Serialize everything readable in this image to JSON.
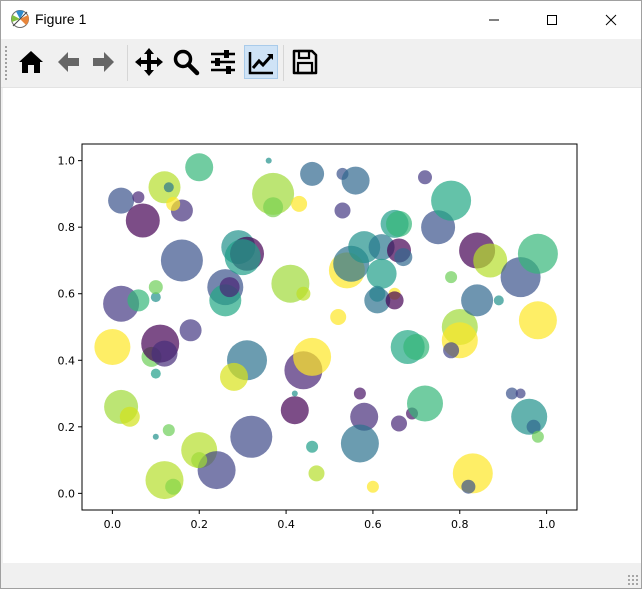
{
  "window": {
    "title": "Figure 1",
    "icon": "matplotlib-icon",
    "controls": [
      "minimize-icon",
      "maximize-icon",
      "close-icon"
    ]
  },
  "toolbar": {
    "buttons": [
      {
        "name": "home",
        "icon": "home-icon"
      },
      {
        "name": "back",
        "icon": "back-arrow-icon"
      },
      {
        "name": "forward",
        "icon": "forward-arrow-icon"
      },
      {
        "name": "pan",
        "icon": "move-icon"
      },
      {
        "name": "zoom",
        "icon": "magnifier-icon"
      },
      {
        "name": "subplots",
        "icon": "sliders-icon"
      },
      {
        "name": "edit-axes",
        "icon": "line-chart-icon",
        "active": true
      },
      {
        "name": "save",
        "icon": "floppy-disk-icon"
      }
    ]
  },
  "chart_data": {
    "type": "scatter",
    "title": "",
    "xlabel": "",
    "ylabel": "",
    "xlim": [
      -0.07,
      1.07
    ],
    "ylim": [
      -0.05,
      1.05
    ],
    "xticks": [
      0.0,
      0.2,
      0.4,
      0.6,
      0.8,
      1.0
    ],
    "yticks": [
      0.0,
      0.2,
      0.4,
      0.6,
      0.8,
      1.0
    ],
    "xtick_labels": [
      "0.0",
      "0.2",
      "0.4",
      "0.6",
      "0.8",
      "1.0"
    ],
    "ytick_labels": [
      "0.0",
      "0.2",
      "0.4",
      "0.6",
      "0.8",
      "1.0"
    ],
    "grid": false,
    "alpha": 0.7,
    "colormap": "viridis",
    "note_size": "marker radius in px",
    "points": [
      {
        "x": 0.02,
        "y": 0.88,
        "r": 13,
        "c": "#3b528b"
      },
      {
        "x": 0.06,
        "y": 0.89,
        "r": 6,
        "c": "#482878"
      },
      {
        "x": 0.07,
        "y": 0.82,
        "r": 17,
        "c": "#440154"
      },
      {
        "x": 0.12,
        "y": 0.92,
        "r": 16,
        "c": "#b5de2b"
      },
      {
        "x": 0.13,
        "y": 0.92,
        "r": 5,
        "c": "#2a788e"
      },
      {
        "x": 0.16,
        "y": 0.85,
        "r": 11,
        "c": "#46327e"
      },
      {
        "x": 0.14,
        "y": 0.87,
        "r": 7,
        "c": "#fde725"
      },
      {
        "x": 0.2,
        "y": 0.98,
        "r": 14,
        "c": "#35b779"
      },
      {
        "x": 0.16,
        "y": 0.7,
        "r": 21,
        "c": "#3b528b"
      },
      {
        "x": 0.02,
        "y": 0.57,
        "r": 18,
        "c": "#443983"
      },
      {
        "x": 0.06,
        "y": 0.58,
        "r": 11,
        "c": "#35b779"
      },
      {
        "x": 0.1,
        "y": 0.59,
        "r": 5,
        "c": "#21918c"
      },
      {
        "x": 0.1,
        "y": 0.62,
        "r": 7,
        "c": "#6ece58"
      },
      {
        "x": 0.0,
        "y": 0.44,
        "r": 18,
        "c": "#fde725"
      },
      {
        "x": 0.09,
        "y": 0.41,
        "r": 10,
        "c": "#6ece58"
      },
      {
        "x": 0.11,
        "y": 0.45,
        "r": 19,
        "c": "#440154"
      },
      {
        "x": 0.12,
        "y": 0.42,
        "r": 13,
        "c": "#472d7b"
      },
      {
        "x": 0.1,
        "y": 0.36,
        "r": 5,
        "c": "#1f9e89"
      },
      {
        "x": 0.18,
        "y": 0.49,
        "r": 11,
        "c": "#443983"
      },
      {
        "x": 0.02,
        "y": 0.26,
        "r": 17,
        "c": "#a0da39"
      },
      {
        "x": 0.04,
        "y": 0.23,
        "r": 10,
        "c": "#d2e21b"
      },
      {
        "x": 0.1,
        "y": 0.17,
        "r": 3,
        "c": "#21918c"
      },
      {
        "x": 0.13,
        "y": 0.19,
        "r": 6,
        "c": "#6ece58"
      },
      {
        "x": 0.12,
        "y": 0.04,
        "r": 19,
        "c": "#b5de2b"
      },
      {
        "x": 0.14,
        "y": 0.02,
        "r": 8,
        "c": "#86d549"
      },
      {
        "x": 0.2,
        "y": 0.13,
        "r": 18,
        "c": "#b5de2b"
      },
      {
        "x": 0.24,
        "y": 0.07,
        "r": 19,
        "c": "#414487"
      },
      {
        "x": 0.2,
        "y": 0.1,
        "r": 8,
        "c": "#a0da39"
      },
      {
        "x": 0.32,
        "y": 0.17,
        "r": 21,
        "c": "#3e4a89"
      },
      {
        "x": 0.31,
        "y": 0.4,
        "r": 20,
        "c": "#2c728e"
      },
      {
        "x": 0.28,
        "y": 0.35,
        "r": 14,
        "c": "#d8e219"
      },
      {
        "x": 0.26,
        "y": 0.62,
        "r": 18,
        "c": "#3b528b"
      },
      {
        "x": 0.26,
        "y": 0.58,
        "r": 16,
        "c": "#22a884"
      },
      {
        "x": 0.27,
        "y": 0.62,
        "r": 10,
        "c": "#482475"
      },
      {
        "x": 0.29,
        "y": 0.74,
        "r": 17,
        "c": "#21918c"
      },
      {
        "x": 0.31,
        "y": 0.72,
        "r": 17,
        "c": "#440154"
      },
      {
        "x": 0.3,
        "y": 0.71,
        "r": 18,
        "c": "#1f9e89"
      },
      {
        "x": 0.37,
        "y": 0.9,
        "r": 21,
        "c": "#a0da39"
      },
      {
        "x": 0.37,
        "y": 0.86,
        "r": 10,
        "c": "#7ad151"
      },
      {
        "x": 0.36,
        "y": 1.0,
        "r": 3,
        "c": "#21918c"
      },
      {
        "x": 0.43,
        "y": 0.87,
        "r": 8,
        "c": "#fde725"
      },
      {
        "x": 0.46,
        "y": 0.96,
        "r": 12,
        "c": "#31688e"
      },
      {
        "x": 0.41,
        "y": 0.63,
        "r": 19,
        "c": "#a0da39"
      },
      {
        "x": 0.44,
        "y": 0.6,
        "r": 7,
        "c": "#bddf26"
      },
      {
        "x": 0.44,
        "y": 0.37,
        "r": 19,
        "c": "#482475"
      },
      {
        "x": 0.46,
        "y": 0.41,
        "r": 19,
        "c": "#fde725"
      },
      {
        "x": 0.42,
        "y": 0.25,
        "r": 14,
        "c": "#440154"
      },
      {
        "x": 0.42,
        "y": 0.3,
        "r": 3,
        "c": "#21918c"
      },
      {
        "x": 0.46,
        "y": 0.14,
        "r": 6,
        "c": "#1f9e89"
      },
      {
        "x": 0.47,
        "y": 0.06,
        "r": 8,
        "c": "#b5de2b"
      },
      {
        "x": 0.53,
        "y": 0.96,
        "r": 6,
        "c": "#3b528b"
      },
      {
        "x": 0.56,
        "y": 0.94,
        "r": 14,
        "c": "#31688e"
      },
      {
        "x": 0.53,
        "y": 0.85,
        "r": 8,
        "c": "#443983"
      },
      {
        "x": 0.54,
        "y": 0.67,
        "r": 18,
        "c": "#fde725"
      },
      {
        "x": 0.55,
        "y": 0.69,
        "r": 18,
        "c": "#2c728e"
      },
      {
        "x": 0.58,
        "y": 0.74,
        "r": 16,
        "c": "#21918c"
      },
      {
        "x": 0.62,
        "y": 0.74,
        "r": 13,
        "c": "#2a788e"
      },
      {
        "x": 0.62,
        "y": 0.66,
        "r": 15,
        "c": "#1f9e89"
      },
      {
        "x": 0.61,
        "y": 0.58,
        "r": 13,
        "c": "#2c728e"
      },
      {
        "x": 0.61,
        "y": 0.6,
        "r": 8,
        "c": "#26828e"
      },
      {
        "x": 0.65,
        "y": 0.6,
        "r": 6,
        "c": "#fde725"
      },
      {
        "x": 0.65,
        "y": 0.58,
        "r": 9,
        "c": "#440154"
      },
      {
        "x": 0.65,
        "y": 0.81,
        "r": 14,
        "c": "#1f9e89"
      },
      {
        "x": 0.66,
        "y": 0.81,
        "r": 13,
        "c": "#35b779"
      },
      {
        "x": 0.66,
        "y": 0.73,
        "r": 12,
        "c": "#440154"
      },
      {
        "x": 0.67,
        "y": 0.71,
        "r": 9,
        "c": "#31688e"
      },
      {
        "x": 0.52,
        "y": 0.53,
        "r": 8,
        "c": "#fde725"
      },
      {
        "x": 0.57,
        "y": 0.3,
        "r": 6,
        "c": "#481467"
      },
      {
        "x": 0.58,
        "y": 0.23,
        "r": 14,
        "c": "#472d7b"
      },
      {
        "x": 0.57,
        "y": 0.15,
        "r": 19,
        "c": "#2c728e"
      },
      {
        "x": 0.6,
        "y": 0.02,
        "r": 6,
        "c": "#fde725"
      },
      {
        "x": 0.66,
        "y": 0.21,
        "r": 8,
        "c": "#482878"
      },
      {
        "x": 0.69,
        "y": 0.24,
        "r": 6,
        "c": "#481467"
      },
      {
        "x": 0.68,
        "y": 0.44,
        "r": 17,
        "c": "#22a884"
      },
      {
        "x": 0.7,
        "y": 0.44,
        "r": 13,
        "c": "#35b779"
      },
      {
        "x": 0.72,
        "y": 0.27,
        "r": 18,
        "c": "#35b779"
      },
      {
        "x": 0.72,
        "y": 0.95,
        "r": 7,
        "c": "#443983"
      },
      {
        "x": 0.75,
        "y": 0.8,
        "r": 17,
        "c": "#3b528b"
      },
      {
        "x": 0.78,
        "y": 0.88,
        "r": 20,
        "c": "#22a884"
      },
      {
        "x": 0.78,
        "y": 0.65,
        "r": 6,
        "c": "#6ece58"
      },
      {
        "x": 0.8,
        "y": 0.5,
        "r": 18,
        "c": "#a0da39"
      },
      {
        "x": 0.8,
        "y": 0.46,
        "r": 18,
        "c": "#fde725"
      },
      {
        "x": 0.78,
        "y": 0.43,
        "r": 8,
        "c": "#414487"
      },
      {
        "x": 0.84,
        "y": 0.73,
        "r": 18,
        "c": "#440154"
      },
      {
        "x": 0.87,
        "y": 0.7,
        "r": 17,
        "c": "#b5de2b"
      },
      {
        "x": 0.84,
        "y": 0.58,
        "r": 16,
        "c": "#31688e"
      },
      {
        "x": 0.89,
        "y": 0.58,
        "r": 5,
        "c": "#21918c"
      },
      {
        "x": 0.94,
        "y": 0.65,
        "r": 20,
        "c": "#3b528b"
      },
      {
        "x": 0.98,
        "y": 0.72,
        "r": 20,
        "c": "#35b779"
      },
      {
        "x": 0.98,
        "y": 0.52,
        "r": 19,
        "c": "#fde725"
      },
      {
        "x": 0.92,
        "y": 0.3,
        "r": 6,
        "c": "#3b528b"
      },
      {
        "x": 0.94,
        "y": 0.3,
        "r": 5,
        "c": "#414487"
      },
      {
        "x": 0.96,
        "y": 0.23,
        "r": 18,
        "c": "#21918c"
      },
      {
        "x": 0.97,
        "y": 0.2,
        "r": 7,
        "c": "#31688e"
      },
      {
        "x": 0.98,
        "y": 0.17,
        "r": 6,
        "c": "#6ece58"
      },
      {
        "x": 0.83,
        "y": 0.06,
        "r": 20,
        "c": "#fde725"
      },
      {
        "x": 0.82,
        "y": 0.02,
        "r": 7,
        "c": "#3b528b"
      }
    ]
  }
}
